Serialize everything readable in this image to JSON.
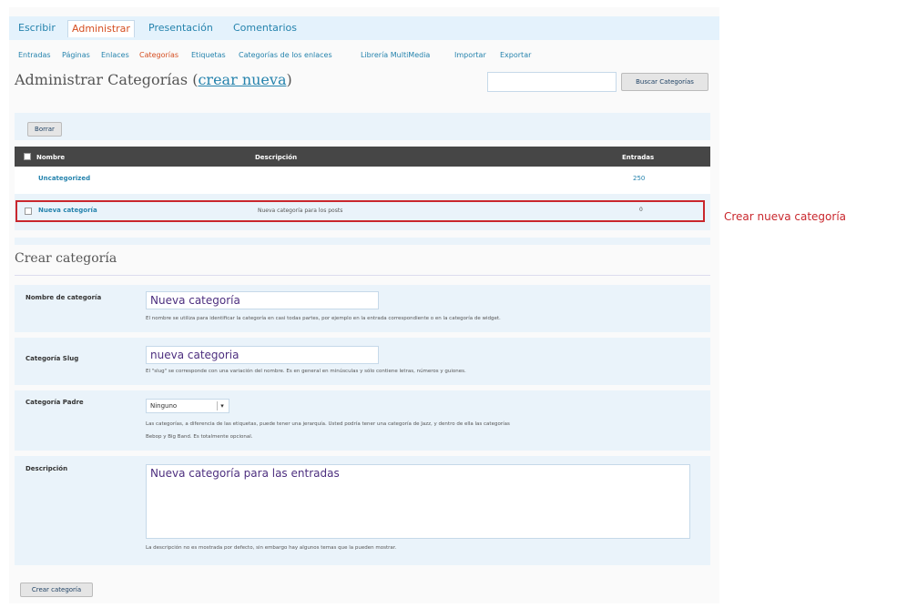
{
  "tabs": [
    "Escribir",
    "Administrar",
    "Presentación",
    "Comentarios"
  ],
  "subnav": [
    "Entradas",
    "Páginas",
    "Enlaces",
    "Categorías",
    "Etiquetas",
    "Categorías de los enlaces",
    "Librería MultiMedia",
    "Importar",
    "Exportar"
  ],
  "header": {
    "title": "Administrar Categorías (",
    "link": "crear nueva",
    "close": ")"
  },
  "search": {
    "button": "Buscar Categorías",
    "value": ""
  },
  "bulk": {
    "delete_button": "Borrar"
  },
  "table": {
    "headers": {
      "name": "Nombre",
      "description": "Descripción",
      "posts": "Entradas"
    },
    "rows": [
      {
        "name": "Uncategorized",
        "description": "",
        "posts": "250"
      },
      {
        "name": "Nueva categoría",
        "description": "Nueva categoría para los posts",
        "posts": "0"
      }
    ]
  },
  "callout": "Crear nueva categoría",
  "form": {
    "title": "Crear categoría",
    "name": {
      "label": "Nombre de categoría",
      "value": "Nueva categoría",
      "hint": "El nombre se utiliza para identificar la categoría en casi todas partes, por ejemplo en la entrada correspondiente o en la categoría de widget."
    },
    "slug": {
      "label": "Categoría Slug",
      "value": "nueva categoria",
      "hint": "El \"slug\" se corresponde con una variación del nombre. Es en general en minúsculas y sólo contiene letras, números y guiones."
    },
    "parent": {
      "label": "Categoría Padre",
      "value": "Ninguno",
      "hint1": "Las categorías, a diferencia de las etiquetas, puede tener una jerarquía. Usted podría tener una categoría de Jazz, y dentro de ella las categorías",
      "hint2": "Bebop y Big Band. Es totalmente opcional."
    },
    "description": {
      "label": "Descripción",
      "value": "Nueva categoría para las entradas",
      "hint": "La descripción no es mostrada por defecto, sin embargo hay algunos temas que la pueden mostrar."
    },
    "submit": "Crear categoría"
  }
}
